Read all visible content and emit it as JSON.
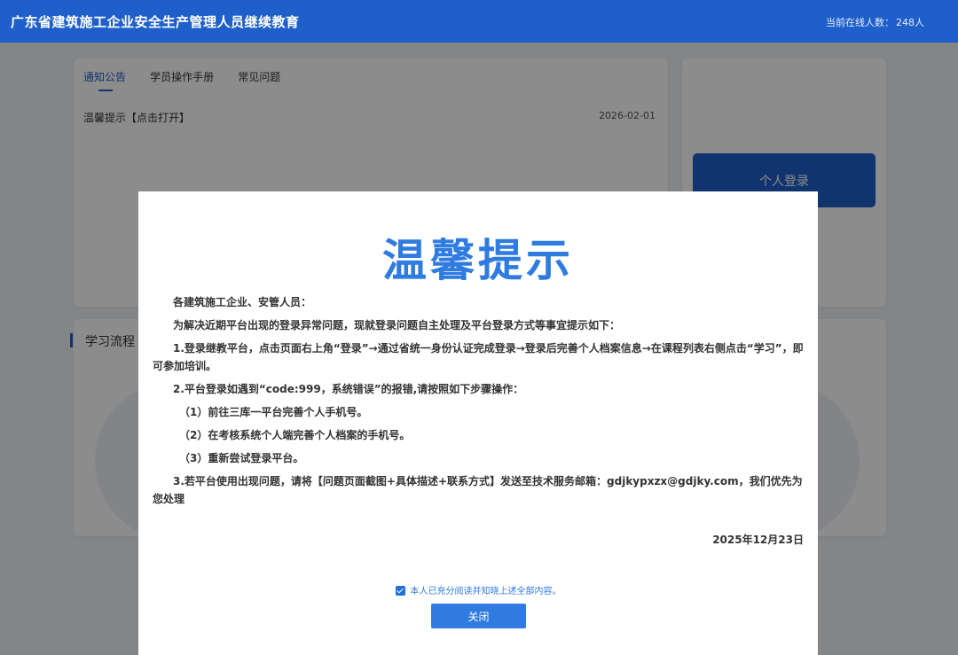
{
  "header": {
    "site_title": "广东省建筑施工企业安全生产管理人员继续教育",
    "online_label": "当前在线人数：",
    "online_count": "248人"
  },
  "notice": {
    "tabs": [
      {
        "label": "通知公告",
        "active": true
      },
      {
        "label": "学员操作手册",
        "active": false
      },
      {
        "label": "常见问题",
        "active": false
      }
    ],
    "items": [
      {
        "title": "温馨提示【点击打开】",
        "date": "2026-02-01"
      }
    ]
  },
  "login": {
    "button_label": "个人登录"
  },
  "process": {
    "section_title": "学习流程"
  },
  "modal": {
    "title": "温馨提示",
    "greeting": "各建筑施工企业、安管人员：",
    "intro": "为解决近期平台出现的登录异常问题，现就登录问题自主处理及平台登录方式等事宜提示如下：",
    "item1": "1.登录继教平台，点击页面右上角“登录”→通过省统一身份认证完成登录→登录后完善个人档案信息→在课程列表右侧点击“学习”，即可参加培训。",
    "item2": "2.平台登录如遇到“code:999，系统错误”的报错,请按照如下步骤操作：",
    "step1": "（1）前往三库一平台完善个人手机号。",
    "step2": "（2）在考核系统个人端完善个人档案的手机号。",
    "step3": "（3）重新尝试登录平台。",
    "item3": "3.若平台使用出现问题，请将【问题页面截图+具体描述+联系方式】发送至技术服务邮箱：gdjkypxzx@gdjky.com，我们优先为您处理",
    "date": "2025年12月23日",
    "agree_label": "本人已充分阅读并知晓上述全部内容。",
    "agree_checked": true,
    "close_label": "关闭"
  },
  "colors": {
    "primary": "#1f5fc9",
    "title_blue": "#2f7be0",
    "overlay": "rgba(0,0,0,0.45)"
  }
}
